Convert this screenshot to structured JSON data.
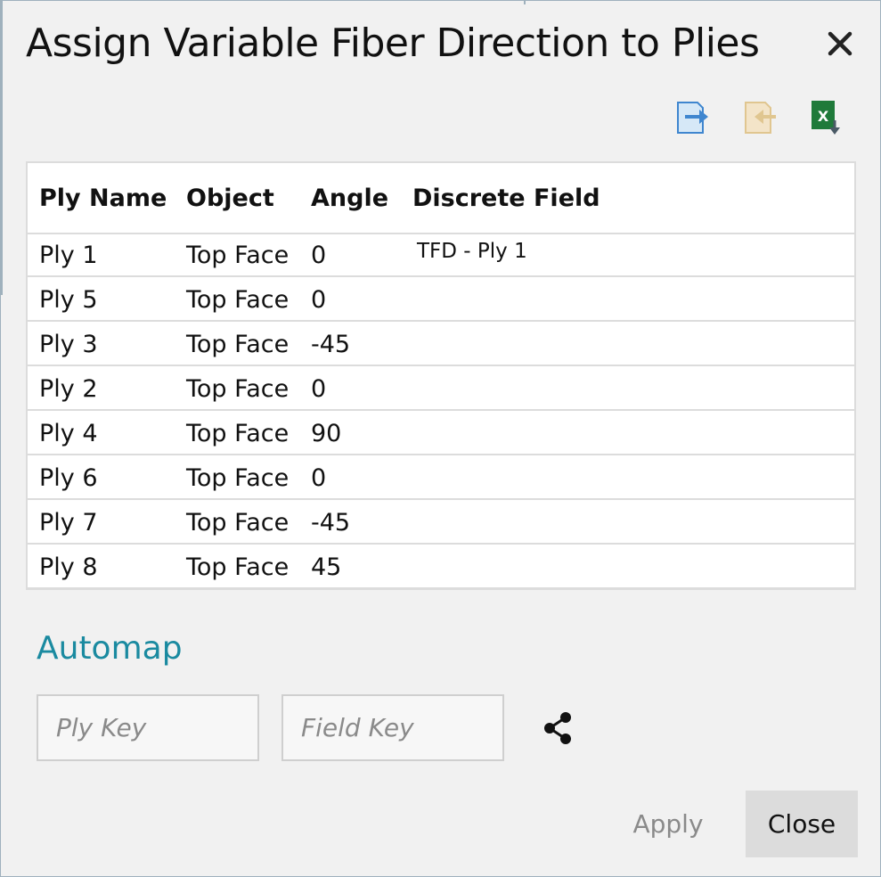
{
  "dialog": {
    "title": "Assign Variable Fiber Direction to Plies",
    "close_icon": "close-icon"
  },
  "toolbar": {
    "icons": [
      "export-icon",
      "import-icon",
      "excel-export-icon"
    ]
  },
  "table": {
    "headers": [
      "Ply Name",
      "Object",
      "Angle",
      "Discrete Field"
    ],
    "rows": [
      {
        "ply": "Ply 1",
        "object": "Top Face",
        "angle": "0",
        "field": "TFD - Ply 1"
      },
      {
        "ply": "Ply 5",
        "object": "Top Face",
        "angle": "0",
        "field": ""
      },
      {
        "ply": "Ply 3",
        "object": "Top Face",
        "angle": "-45",
        "field": ""
      },
      {
        "ply": "Ply 2",
        "object": "Top Face",
        "angle": "0",
        "field": ""
      },
      {
        "ply": "Ply 4",
        "object": "Top Face",
        "angle": "90",
        "field": ""
      },
      {
        "ply": "Ply 6",
        "object": "Top Face",
        "angle": "0",
        "field": ""
      },
      {
        "ply": "Ply 7",
        "object": "Top Face",
        "angle": "-45",
        "field": ""
      },
      {
        "ply": "Ply 8",
        "object": "Top Face",
        "angle": "45",
        "field": ""
      }
    ]
  },
  "automap": {
    "label": "Automap",
    "ply_key_placeholder": "Ply Key",
    "field_key_placeholder": "Field Key",
    "ply_key_value": "",
    "field_key_value": "",
    "share_icon": "share-icon"
  },
  "buttons": {
    "apply": "Apply",
    "close": "Close"
  },
  "colors": {
    "accent": "#1a8aa0",
    "export_blue": "#3f86cf",
    "import_tan": "#e7cfa4",
    "excel_green": "#1f7a3a"
  }
}
